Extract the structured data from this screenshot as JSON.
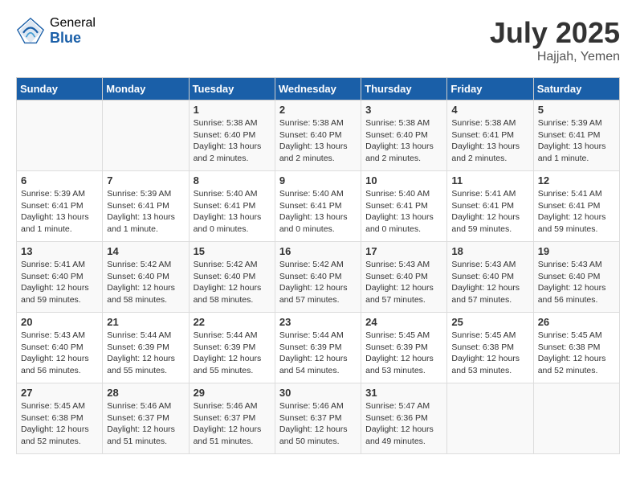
{
  "logo": {
    "general": "General",
    "blue": "Blue"
  },
  "title": "July 2025",
  "subtitle": "Hajjah, Yemen",
  "headers": [
    "Sunday",
    "Monday",
    "Tuesday",
    "Wednesday",
    "Thursday",
    "Friday",
    "Saturday"
  ],
  "weeks": [
    [
      {
        "day": "",
        "sunrise": "",
        "sunset": "",
        "daylight": ""
      },
      {
        "day": "",
        "sunrise": "",
        "sunset": "",
        "daylight": ""
      },
      {
        "day": "1",
        "sunrise": "Sunrise: 5:38 AM",
        "sunset": "Sunset: 6:40 PM",
        "daylight": "Daylight: 13 hours and 2 minutes."
      },
      {
        "day": "2",
        "sunrise": "Sunrise: 5:38 AM",
        "sunset": "Sunset: 6:40 PM",
        "daylight": "Daylight: 13 hours and 2 minutes."
      },
      {
        "day": "3",
        "sunrise": "Sunrise: 5:38 AM",
        "sunset": "Sunset: 6:40 PM",
        "daylight": "Daylight: 13 hours and 2 minutes."
      },
      {
        "day": "4",
        "sunrise": "Sunrise: 5:38 AM",
        "sunset": "Sunset: 6:41 PM",
        "daylight": "Daylight: 13 hours and 2 minutes."
      },
      {
        "day": "5",
        "sunrise": "Sunrise: 5:39 AM",
        "sunset": "Sunset: 6:41 PM",
        "daylight": "Daylight: 13 hours and 1 minute."
      }
    ],
    [
      {
        "day": "6",
        "sunrise": "Sunrise: 5:39 AM",
        "sunset": "Sunset: 6:41 PM",
        "daylight": "Daylight: 13 hours and 1 minute."
      },
      {
        "day": "7",
        "sunrise": "Sunrise: 5:39 AM",
        "sunset": "Sunset: 6:41 PM",
        "daylight": "Daylight: 13 hours and 1 minute."
      },
      {
        "day": "8",
        "sunrise": "Sunrise: 5:40 AM",
        "sunset": "Sunset: 6:41 PM",
        "daylight": "Daylight: 13 hours and 0 minutes."
      },
      {
        "day": "9",
        "sunrise": "Sunrise: 5:40 AM",
        "sunset": "Sunset: 6:41 PM",
        "daylight": "Daylight: 13 hours and 0 minutes."
      },
      {
        "day": "10",
        "sunrise": "Sunrise: 5:40 AM",
        "sunset": "Sunset: 6:41 PM",
        "daylight": "Daylight: 13 hours and 0 minutes."
      },
      {
        "day": "11",
        "sunrise": "Sunrise: 5:41 AM",
        "sunset": "Sunset: 6:41 PM",
        "daylight": "Daylight: 12 hours and 59 minutes."
      },
      {
        "day": "12",
        "sunrise": "Sunrise: 5:41 AM",
        "sunset": "Sunset: 6:41 PM",
        "daylight": "Daylight: 12 hours and 59 minutes."
      }
    ],
    [
      {
        "day": "13",
        "sunrise": "Sunrise: 5:41 AM",
        "sunset": "Sunset: 6:40 PM",
        "daylight": "Daylight: 12 hours and 59 minutes."
      },
      {
        "day": "14",
        "sunrise": "Sunrise: 5:42 AM",
        "sunset": "Sunset: 6:40 PM",
        "daylight": "Daylight: 12 hours and 58 minutes."
      },
      {
        "day": "15",
        "sunrise": "Sunrise: 5:42 AM",
        "sunset": "Sunset: 6:40 PM",
        "daylight": "Daylight: 12 hours and 58 minutes."
      },
      {
        "day": "16",
        "sunrise": "Sunrise: 5:42 AM",
        "sunset": "Sunset: 6:40 PM",
        "daylight": "Daylight: 12 hours and 57 minutes."
      },
      {
        "day": "17",
        "sunrise": "Sunrise: 5:43 AM",
        "sunset": "Sunset: 6:40 PM",
        "daylight": "Daylight: 12 hours and 57 minutes."
      },
      {
        "day": "18",
        "sunrise": "Sunrise: 5:43 AM",
        "sunset": "Sunset: 6:40 PM",
        "daylight": "Daylight: 12 hours and 57 minutes."
      },
      {
        "day": "19",
        "sunrise": "Sunrise: 5:43 AM",
        "sunset": "Sunset: 6:40 PM",
        "daylight": "Daylight: 12 hours and 56 minutes."
      }
    ],
    [
      {
        "day": "20",
        "sunrise": "Sunrise: 5:43 AM",
        "sunset": "Sunset: 6:40 PM",
        "daylight": "Daylight: 12 hours and 56 minutes."
      },
      {
        "day": "21",
        "sunrise": "Sunrise: 5:44 AM",
        "sunset": "Sunset: 6:39 PM",
        "daylight": "Daylight: 12 hours and 55 minutes."
      },
      {
        "day": "22",
        "sunrise": "Sunrise: 5:44 AM",
        "sunset": "Sunset: 6:39 PM",
        "daylight": "Daylight: 12 hours and 55 minutes."
      },
      {
        "day": "23",
        "sunrise": "Sunrise: 5:44 AM",
        "sunset": "Sunset: 6:39 PM",
        "daylight": "Daylight: 12 hours and 54 minutes."
      },
      {
        "day": "24",
        "sunrise": "Sunrise: 5:45 AM",
        "sunset": "Sunset: 6:39 PM",
        "daylight": "Daylight: 12 hours and 53 minutes."
      },
      {
        "day": "25",
        "sunrise": "Sunrise: 5:45 AM",
        "sunset": "Sunset: 6:38 PM",
        "daylight": "Daylight: 12 hours and 53 minutes."
      },
      {
        "day": "26",
        "sunrise": "Sunrise: 5:45 AM",
        "sunset": "Sunset: 6:38 PM",
        "daylight": "Daylight: 12 hours and 52 minutes."
      }
    ],
    [
      {
        "day": "27",
        "sunrise": "Sunrise: 5:45 AM",
        "sunset": "Sunset: 6:38 PM",
        "daylight": "Daylight: 12 hours and 52 minutes."
      },
      {
        "day": "28",
        "sunrise": "Sunrise: 5:46 AM",
        "sunset": "Sunset: 6:37 PM",
        "daylight": "Daylight: 12 hours and 51 minutes."
      },
      {
        "day": "29",
        "sunrise": "Sunrise: 5:46 AM",
        "sunset": "Sunset: 6:37 PM",
        "daylight": "Daylight: 12 hours and 51 minutes."
      },
      {
        "day": "30",
        "sunrise": "Sunrise: 5:46 AM",
        "sunset": "Sunset: 6:37 PM",
        "daylight": "Daylight: 12 hours and 50 minutes."
      },
      {
        "day": "31",
        "sunrise": "Sunrise: 5:47 AM",
        "sunset": "Sunset: 6:36 PM",
        "daylight": "Daylight: 12 hours and 49 minutes."
      },
      {
        "day": "",
        "sunrise": "",
        "sunset": "",
        "daylight": ""
      },
      {
        "day": "",
        "sunrise": "",
        "sunset": "",
        "daylight": ""
      }
    ]
  ]
}
